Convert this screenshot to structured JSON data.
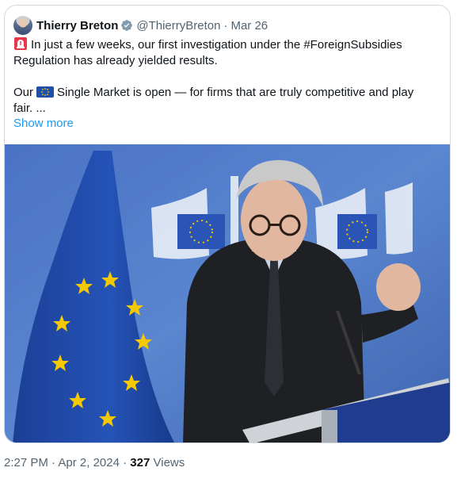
{
  "tweet": {
    "author_name": "Thierry Breton",
    "handle": "@ThierryBreton",
    "separator": "·",
    "date": "Mar 26",
    "lines": [
      "In just a few weeks, our first investigation under the #ForeignSubsidies",
      "Regulation has already yielded results.",
      "Our",
      "Single Market is open — for firms that are truly competitive and play",
      "fair. ..."
    ],
    "show_more": "Show more"
  },
  "footer": {
    "time": "2:27 PM",
    "separator": "·",
    "date": "Apr 2, 2024",
    "views_count": "327",
    "views_label": "Views"
  },
  "icons": {
    "verified": "verified-badge-icon",
    "siren": "rotating-light-emoji",
    "flag": "eu-flag-emoji"
  },
  "colors": {
    "accent": "#1d9bf0",
    "secondary_text": "#536471",
    "border": "#cfd9de"
  }
}
